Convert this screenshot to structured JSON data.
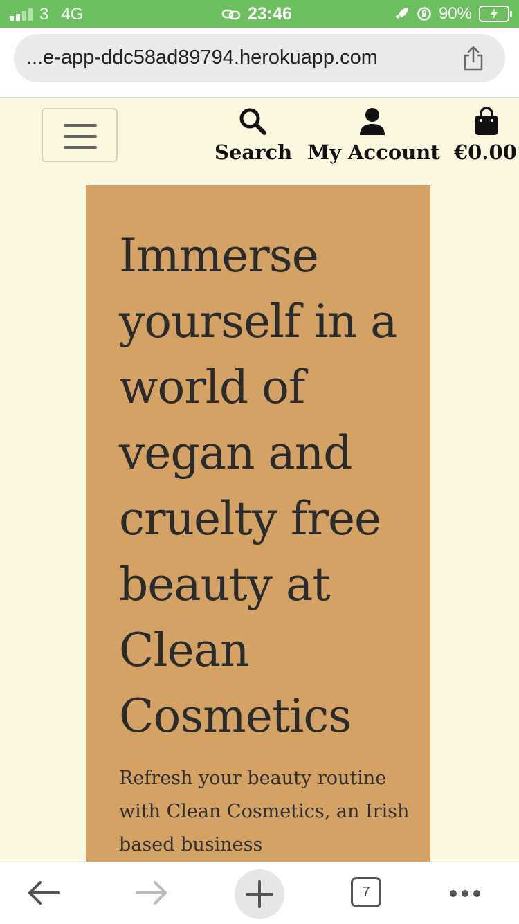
{
  "status_bar": {
    "carrier": "3",
    "network": "4G",
    "time": "23:46",
    "battery": "90%"
  },
  "browser": {
    "url": "...e-app-ddc58ad89794.herokuapp.com",
    "tab_count": "7"
  },
  "nav": {
    "search_label": "Search",
    "account_label": "My Account",
    "bag_total": "€0.00"
  },
  "hero": {
    "title": "Immerse yourself in a world of vegan and cruelty free beauty at Clean Cosmetics",
    "subtitle": "Refresh your beauty routine with Clean Cosmetics, an Irish based business"
  },
  "colors": {
    "status_bar": "#6cc05f",
    "page_background": "#fbf8df",
    "hero_background": "#d4a265"
  }
}
